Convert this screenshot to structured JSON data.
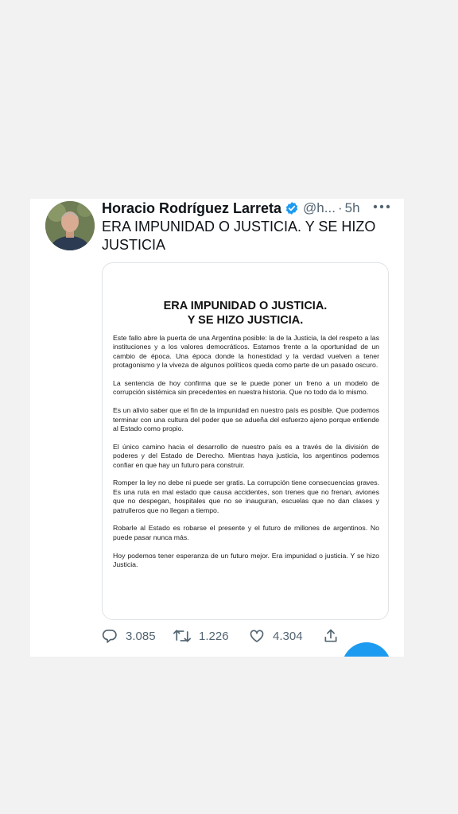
{
  "tweet": {
    "author_name": "Horacio Rodríguez Larreta",
    "handle": "@h...",
    "separator": "·",
    "time": "5h",
    "text": "ERA IMPUNIDAD O JUSTICIA. Y SE HIZO JUSTICIA",
    "more_icon": "more-horizontal-icon",
    "verified_icon": "verified-badge-icon",
    "verified_color": "#1d9bf0"
  },
  "document": {
    "title_line1": "ERA IMPUNIDAD O JUSTICIA.",
    "title_line2": "Y SE HIZO JUSTICIA.",
    "paragraphs": [
      "Este fallo abre la puerta de una Argentina posible: la de la Justicia, la del respeto a las instituciones y a los valores democráticos. Estamos frente a la oportunidad de un cambio de época. Una época donde la honestidad y la verdad vuelven a tener protagonismo y la viveza de algunos políticos queda como parte de un pasado oscuro.",
      "La sentencia de hoy confirma que se le puede poner un freno a un modelo de corrupción sistémica sin precedentes en nuestra historia. Que no todo da lo mismo.",
      "Es un alivio saber que el fin de la impunidad en nuestro país es posible. Que podemos terminar con una cultura del poder que se adueña del esfuerzo ajeno porque entiende al Estado como propio.",
      "El único camino hacia el desarrollo de nuestro país es a través de la división de poderes y del Estado de Derecho. Mientras haya justicia, los argentinos podemos confiar en que hay un futuro para construir.",
      "Romper la ley no debe ni puede ser gratis. La corrupción tiene consecuencias graves. Es una ruta en mal estado que causa accidentes, son trenes que no frenan, aviones que no despegan, hospitales que no se inauguran, escuelas que no dan clases y patrulleros que no llegan a tiempo.",
      "Robarle al Estado es robarse el presente y el futuro de millones de argentinos. No puede pasar nunca más.",
      "Hoy podemos tener esperanza de un futuro mejor. Era impunidad o justicia. Y se hizo Justicia."
    ]
  },
  "actions": {
    "replies": "3.085",
    "retweets": "1.226",
    "likes": "4.304",
    "icons": [
      "reply-icon",
      "retweet-icon",
      "like-icon",
      "share-icon"
    ],
    "icon_color": "#536471"
  },
  "fab": {
    "color": "#1d9bf0",
    "icon": "compose-tweet-icon"
  }
}
